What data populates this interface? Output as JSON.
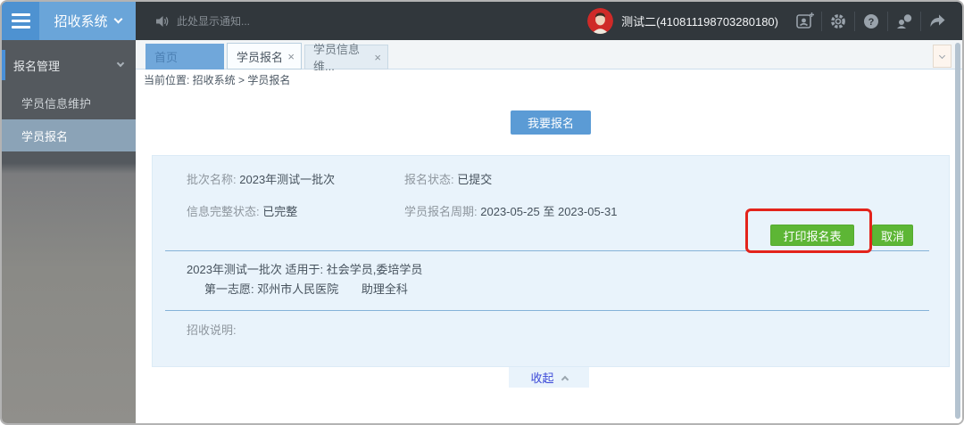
{
  "topbar": {
    "brand": "招收系统",
    "notice": "此处显示通知...",
    "user": "测试二(410811198703280180)",
    "icon_names": [
      "menu-hamburger-icon",
      "speaker-icon",
      "avatar",
      "id-card-add-icon",
      "settings-gear-icon",
      "help-icon",
      "feedback-person-icon",
      "forward-arrow-icon"
    ]
  },
  "sidebar": {
    "group": "报名管理",
    "items": [
      {
        "label": "学员信息维护"
      },
      {
        "label": "学员报名"
      }
    ]
  },
  "tabs": {
    "home": "首页",
    "tab1": {
      "label": "学员报名",
      "close": "×"
    },
    "tab2": {
      "label": "学员信息维...",
      "close": "×"
    }
  },
  "breadcrumb": "当前位置: 招收系统 > 学员报名",
  "main": {
    "apply_button": "我要报名",
    "panel": {
      "batch_label": "批次名称:",
      "batch_value": "2023年测试一批次",
      "status_label": "报名状态:",
      "status_value": "已提交",
      "complete_label": "信息完整状态:",
      "complete_value": "已完整",
      "period_label": "学员报名周期:",
      "period_value": "2023-05-25 至 2023-05-31",
      "print_button": "打印报名表",
      "cancel_button": "取消",
      "batch_line": "2023年测试一批次 适用于: 社会学员,委培学员",
      "first_choice_label": "第一志愿: 邓州市人民医院",
      "first_choice_value": "助理全科",
      "desc_label": "招收说明:"
    },
    "collapse_label": "收起"
  },
  "colors": {
    "topbar_bg": "#31373c",
    "brand_bg": "#6aa5d9",
    "hamburger_bg": "#4e92d1",
    "accent_blue": "#5b9bd5",
    "button_green": "#5db635",
    "annotation_red": "#e3231b",
    "panel_bg": "#e9f3fb",
    "sidebar_dark": "#54595e",
    "sidebar_active": "#8ba3b7",
    "collapse_text": "#3c49d8"
  }
}
